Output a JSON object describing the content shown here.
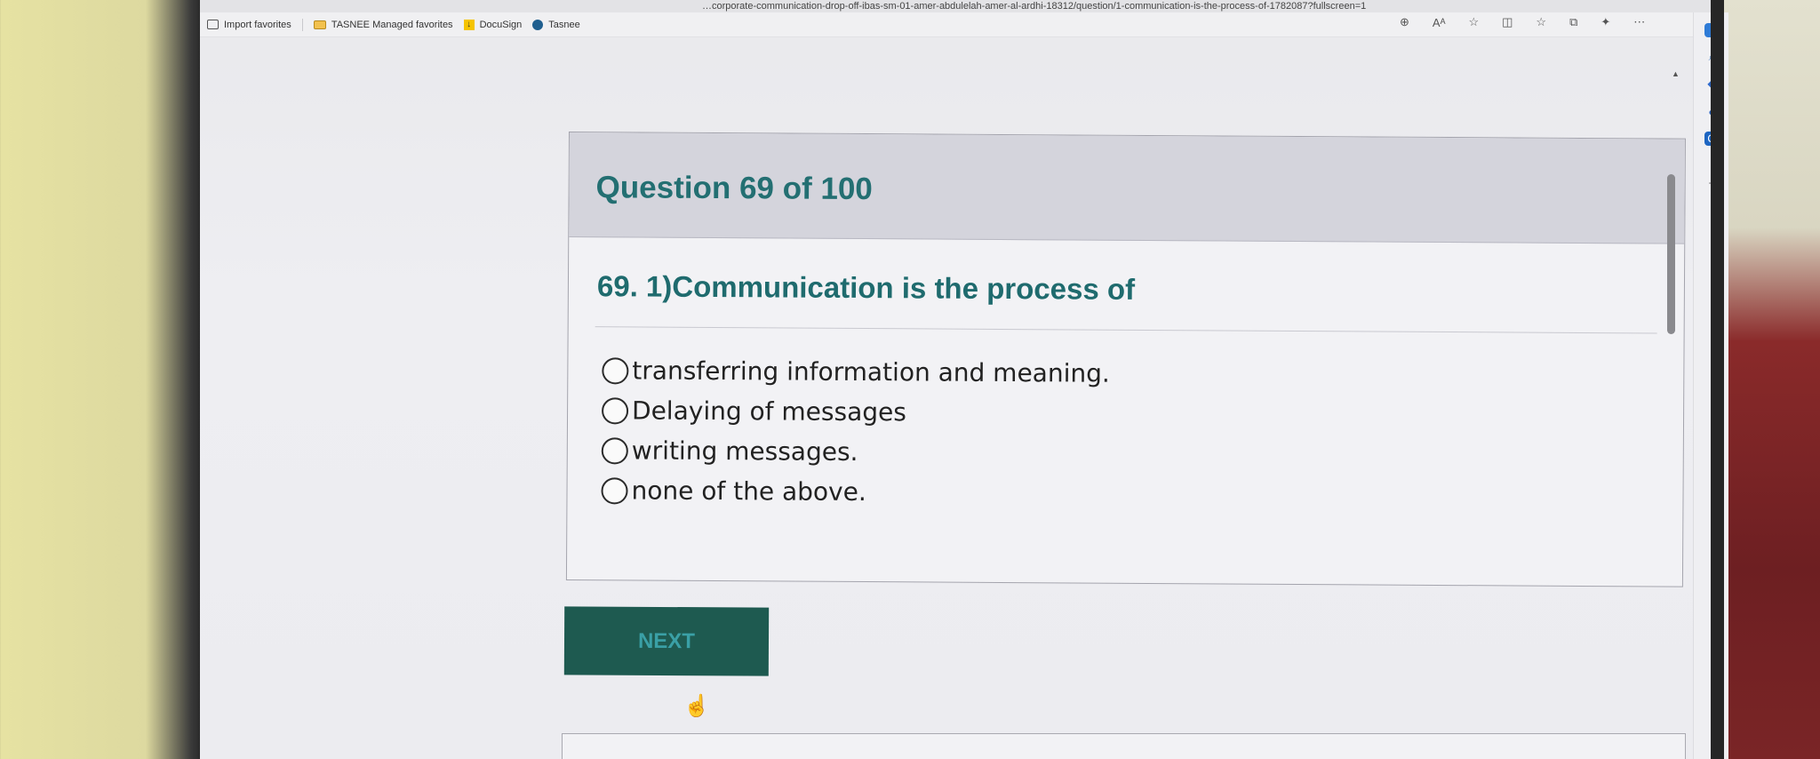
{
  "browser": {
    "url": "…corporate-communication-drop-off-ibas-sm-01-amer-abdulelah-amer-al-ardhi-18312/question/1-communication-is-the-process-of-1782087?fullscreen=1",
    "favorites": [
      {
        "label": "Import favorites",
        "icon": "import-icon"
      },
      {
        "label": "TASNEE Managed favorites",
        "icon": "folder-icon"
      },
      {
        "label": "DocuSign",
        "icon": "docusign-icon"
      },
      {
        "label": "Tasnee",
        "icon": "tasnee-icon"
      }
    ],
    "toolbar_icons": [
      "zoom-icon",
      "read-aloud-icon",
      "favorite-star-icon",
      "split-screen-icon",
      "favorites-icon",
      "collections-icon",
      "extensions-icon",
      "more-icon"
    ],
    "toolbar_glyphs": [
      "⊕",
      "Aᴬ",
      "☆",
      "◫",
      "☆",
      "⧉",
      "✦",
      "⋯"
    ],
    "sidebar_icons": [
      "copilot-icon",
      "search-icon",
      "shopping-icon",
      "tools-icon",
      "outlook-icon",
      "add-icon"
    ],
    "sidebar_glyphs": [
      "",
      "⌕",
      "◆",
      "●",
      "O",
      "+"
    ]
  },
  "quiz": {
    "header": "Question 69 of 100",
    "question": "69. 1)Communication is the process of",
    "options": [
      "transferring information and meaning.",
      "Delaying of messages",
      "writing messages.",
      "none of the above."
    ],
    "next_label": "NEXT"
  },
  "colors": {
    "header_bg": "#d4d4dc",
    "title_teal": "#236f72",
    "next_bg": "#1e5a50",
    "next_text": "#3aa0a6"
  }
}
